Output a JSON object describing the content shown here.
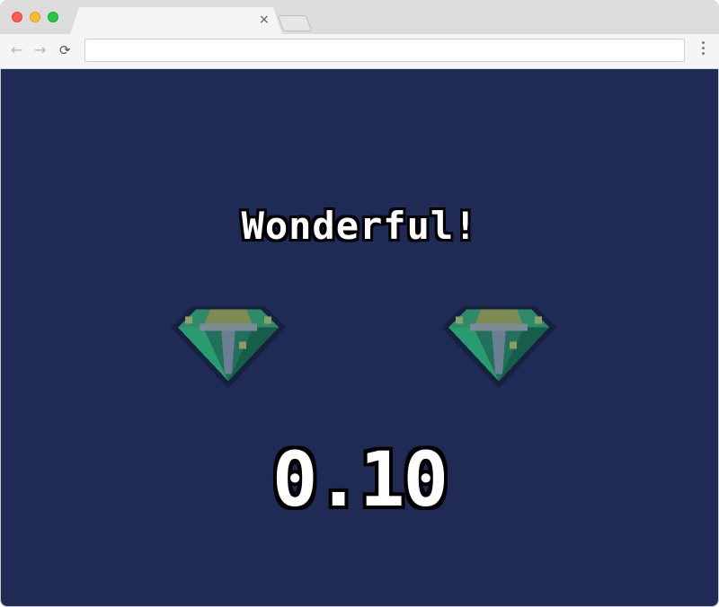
{
  "browser": {
    "tab_close_glyph": "×",
    "nav": {
      "back_icon": "arrow-left-icon",
      "forward_icon": "arrow-right-icon",
      "reload_icon": "reload-icon"
    },
    "address_bar_value": ""
  },
  "game": {
    "background_color": "#1f2a55",
    "message": "Wonderful!",
    "score": "0.10",
    "icons": [
      "emerald-gem-icon",
      "emerald-gem-icon"
    ]
  }
}
